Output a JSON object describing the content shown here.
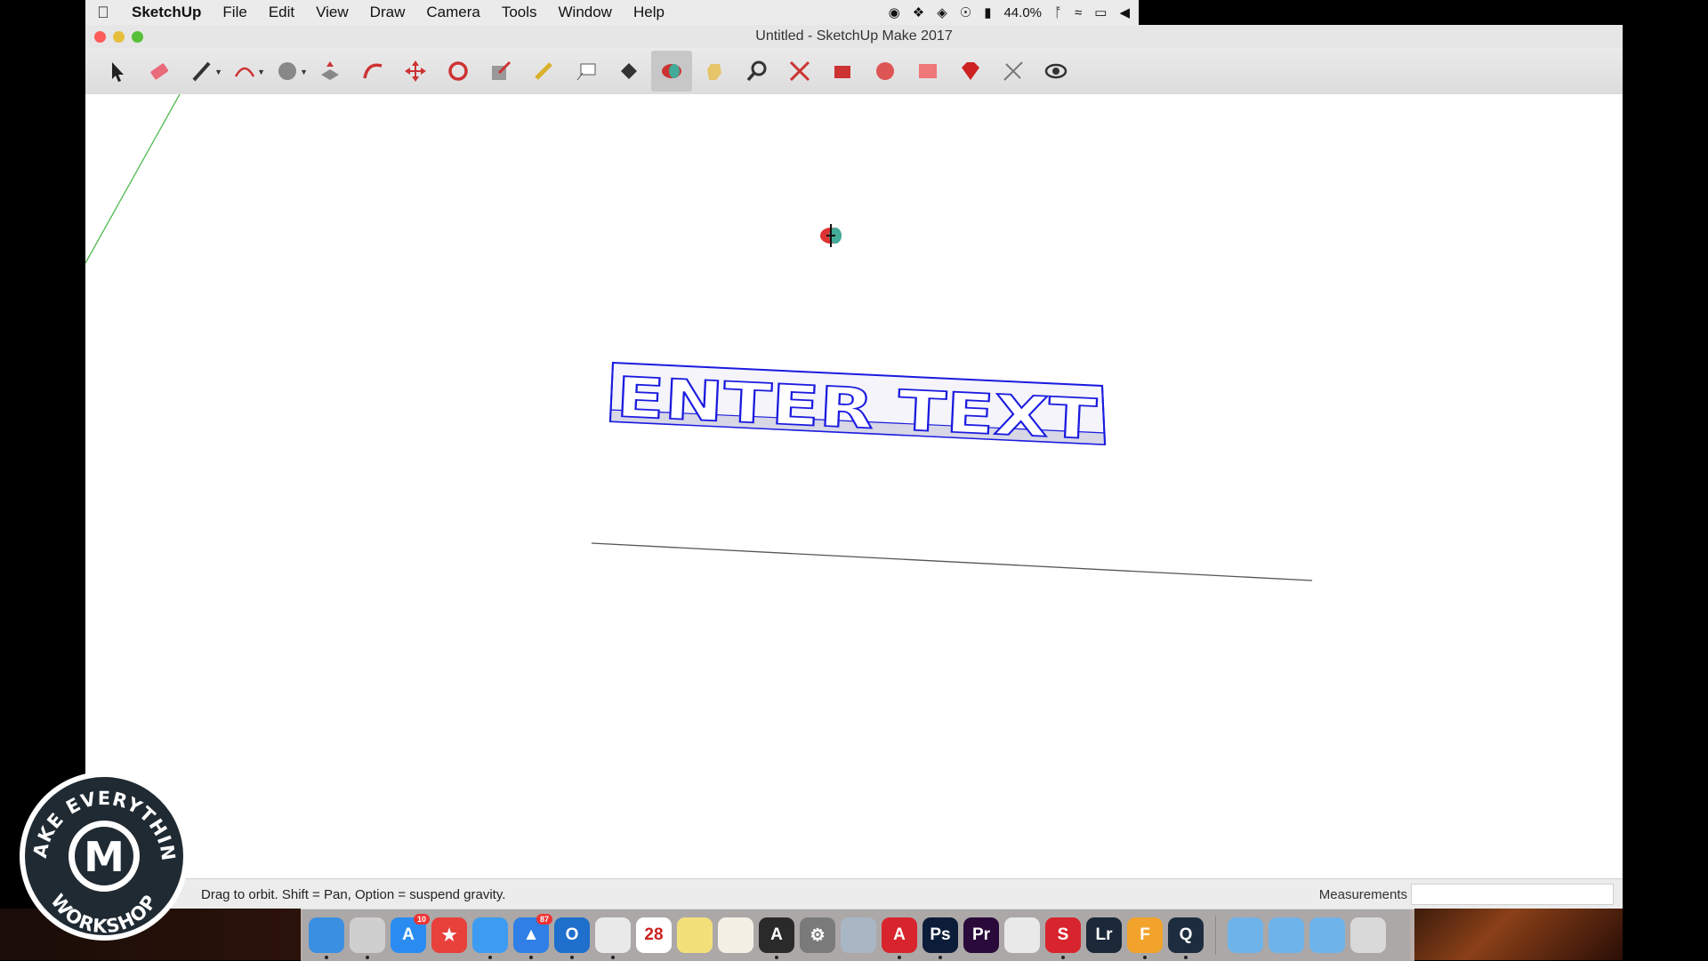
{
  "menubar": {
    "app_name": "SketchUp",
    "items": [
      "File",
      "Edit",
      "View",
      "Draw",
      "Camera",
      "Tools",
      "Window",
      "Help"
    ],
    "battery": "44.0%"
  },
  "window": {
    "title": "Untitled - SketchUp Make 2017"
  },
  "toolbar": {
    "tools": [
      {
        "name": "select-icon",
        "color": "#222"
      },
      {
        "name": "eraser-icon",
        "color": "#e96a7a"
      },
      {
        "name": "pencil-icon",
        "color": "#333",
        "dropdown": true
      },
      {
        "name": "arc-icon",
        "color": "#c33",
        "dropdown": true
      },
      {
        "name": "shapes-icon",
        "color": "#888",
        "dropdown": true
      },
      {
        "name": "push-pull-icon",
        "color": "#c33"
      },
      {
        "name": "follow-me-icon",
        "color": "#c33"
      },
      {
        "name": "move-icon",
        "color": "#c33"
      },
      {
        "name": "rotate-icon",
        "color": "#c33"
      },
      {
        "name": "scale-icon",
        "color": "#c33"
      },
      {
        "name": "tape-measure-icon",
        "color": "#d9b02a"
      },
      {
        "name": "text-icon",
        "color": "#555"
      },
      {
        "name": "paint-bucket-icon",
        "color": "#333"
      },
      {
        "name": "orbit-icon",
        "color": "#c33",
        "active": true
      },
      {
        "name": "pan-icon",
        "color": "#e5c46a"
      },
      {
        "name": "zoom-icon",
        "color": "#333"
      },
      {
        "name": "zoom-extents-icon",
        "color": "#c33"
      },
      {
        "name": "warehouse-icon",
        "color": "#c33"
      },
      {
        "name": "extension-warehouse-icon",
        "color": "#d55"
      },
      {
        "name": "layout-icon",
        "color": "#e77"
      },
      {
        "name": "ruby-icon",
        "color": "#c22"
      },
      {
        "name": "sandbox-icon",
        "color": "#777"
      },
      {
        "name": "look-around-icon",
        "color": "#333"
      }
    ]
  },
  "model": {
    "text": "ENTER TEXT",
    "edge_color": "#1a1ae0"
  },
  "statusbar": {
    "hint": "Drag to orbit. Shift = Pan, Option = suspend gravity.",
    "measurements_label": "Measurements",
    "measurements_value": ""
  },
  "dock": {
    "apps": [
      {
        "name": "finder-icon",
        "color": "#3b8fe0",
        "label": "",
        "running": true
      },
      {
        "name": "iphone-icon",
        "color": "#cfcfcf",
        "label": "",
        "running": true
      },
      {
        "name": "app-store-icon",
        "color": "#2a8cf0",
        "label": "A",
        "badge": "10"
      },
      {
        "name": "reeder-icon",
        "color": "#e8413c",
        "label": "★"
      },
      {
        "name": "safari-icon",
        "color": "#3d9cf2",
        "label": "",
        "running": true
      },
      {
        "name": "spark-icon",
        "color": "#2f7fe6",
        "label": "▲",
        "badge": "87",
        "running": true
      },
      {
        "name": "outlook-icon",
        "color": "#1f6fcc",
        "label": "O",
        "running": true
      },
      {
        "name": "chrome-icon",
        "color": "#e9e9e9",
        "label": "",
        "running": true
      },
      {
        "name": "calendar-icon",
        "color": "#ffffff",
        "label": "28"
      },
      {
        "name": "stickies-icon",
        "color": "#f3e07a",
        "label": ""
      },
      {
        "name": "preview-icon",
        "color": "#f4f0e6",
        "label": ""
      },
      {
        "name": "acrobat-icon",
        "color": "#2a2a2a",
        "label": "A",
        "running": true
      },
      {
        "name": "system-preferences-icon",
        "color": "#7a7a7a",
        "label": "⚙"
      },
      {
        "name": "image-capture-icon",
        "color": "#a9b6c4",
        "label": ""
      },
      {
        "name": "autocad-icon",
        "color": "#d8242c",
        "label": "A",
        "running": true
      },
      {
        "name": "photoshop-icon",
        "color": "#0c1d3a",
        "label": "Ps",
        "running": true
      },
      {
        "name": "premiere-icon",
        "color": "#2a0a3a",
        "label": "Pr"
      },
      {
        "name": "numbers-icon",
        "color": "#e9e9e9",
        "label": ""
      },
      {
        "name": "sketchup-icon",
        "color": "#d8242c",
        "label": "S",
        "running": true
      },
      {
        "name": "lightroom-icon",
        "color": "#1b2838",
        "label": "Lr"
      },
      {
        "name": "fusion-360-icon",
        "color": "#f1a32b",
        "label": "F",
        "running": true
      },
      {
        "name": "quicktime-icon",
        "color": "#1d2d3f",
        "label": "Q",
        "running": true
      },
      {
        "name": "applications-folder-icon",
        "color": "#6eb3ea",
        "label": "",
        "separator_before": true
      },
      {
        "name": "documents-folder-icon",
        "color": "#6eb3ea",
        "label": ""
      },
      {
        "name": "downloads-folder-icon",
        "color": "#6eb3ea",
        "label": ""
      },
      {
        "name": "trash-icon",
        "color": "#d9d9d9",
        "label": ""
      }
    ]
  },
  "watermark": {
    "top_text": "MAKE EVERYTHING",
    "bottom_text": "WORKSHOP",
    "monogram": "M"
  }
}
